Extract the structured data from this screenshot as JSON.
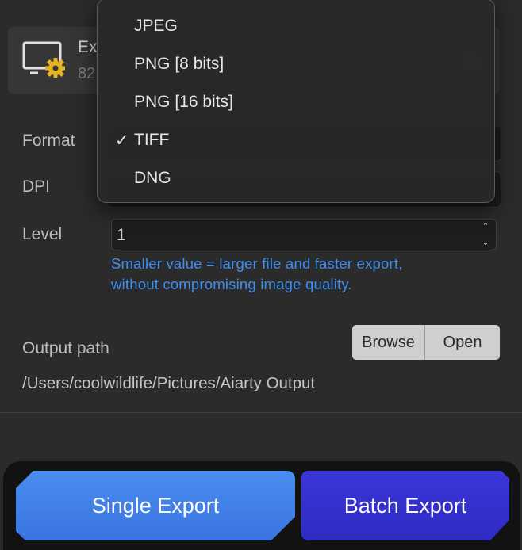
{
  "export_card": {
    "title": "Ex",
    "subtitle": "82"
  },
  "form": {
    "format_label": "Format",
    "dpi_label": "DPI",
    "level_label": "Level",
    "level_value": "1",
    "hint_line1": "Smaller value = larger file and faster export,",
    "hint_line2": "without compromising image quality.",
    "output_path_label": "Output path",
    "output_path_value": "/Users/coolwildlife/Pictures/Aiarty Output",
    "browse_label": "Browse",
    "open_label": "Open"
  },
  "format_menu": {
    "options": [
      {
        "label": "JPEG",
        "checked": false
      },
      {
        "label": "PNG [8 bits]",
        "checked": false
      },
      {
        "label": "PNG [16 bits]",
        "checked": false
      },
      {
        "label": "TIFF",
        "checked": true
      },
      {
        "label": "DNG",
        "checked": false
      }
    ],
    "check_glyph": "✓"
  },
  "actions": {
    "single_export_label": "Single Export",
    "batch_export_label": "Batch Export"
  },
  "colors": {
    "hint": "#3d8ef2",
    "single_export": "#4a8ef0",
    "batch_export": "#3b36d8",
    "gear_icon": "#e6b422"
  }
}
